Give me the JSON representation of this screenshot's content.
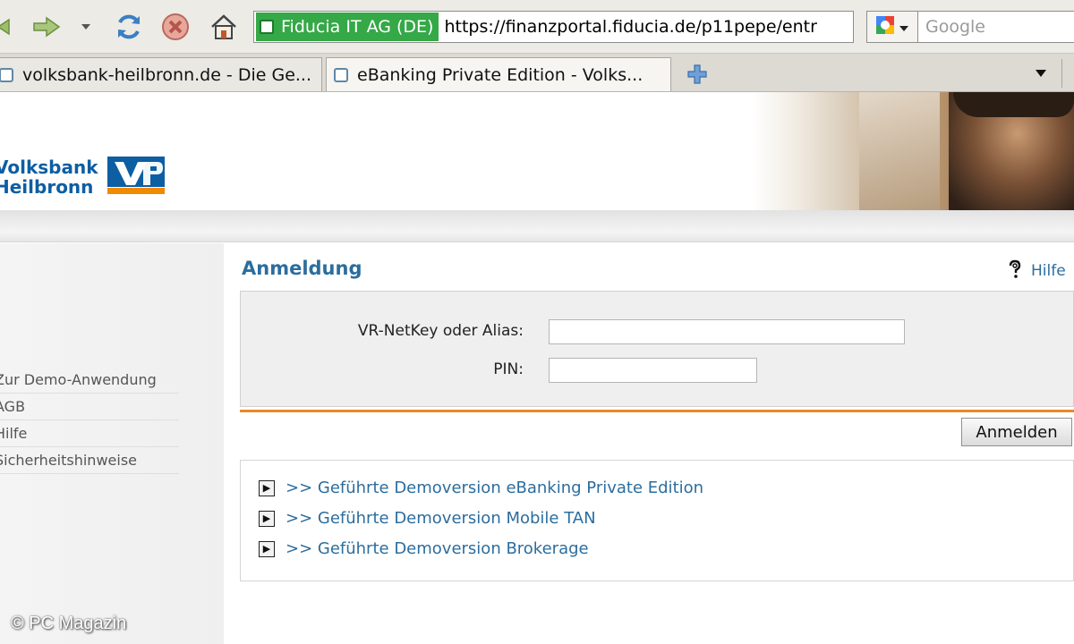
{
  "browser": {
    "identity_label": "Fiducia IT AG (DE)",
    "url": "https://finanzportal.fiducia.de/p11pepe/entr",
    "search_placeholder": "Google",
    "tabs": [
      {
        "title": "volksbank-heilbronn.de - Die Ge..."
      },
      {
        "title": "eBanking Private Edition - Volks..."
      }
    ]
  },
  "header": {
    "logo_line1": "Volksbank",
    "logo_line2": "Heilbronn"
  },
  "sidebar": {
    "items": [
      {
        "label": "Zur Demo-Anwendung"
      },
      {
        "label": "AGB"
      },
      {
        "label": "Hilfe"
      },
      {
        "label": "Sicherheitshinweise"
      }
    ]
  },
  "main": {
    "title": "Anmeldung",
    "help_label": "Hilfe",
    "netkey_label": "VR-NetKey oder Alias:",
    "pin_label": "PIN:",
    "netkey_value": "",
    "pin_value": "",
    "submit_label": "Anmelden",
    "demo_links": [
      {
        "label": ">> Geführte Demoversion eBanking Private Edition"
      },
      {
        "label": ">> Geführte Demoversion Mobile TAN"
      },
      {
        "label": ">> Geführte Demoversion Brokerage"
      }
    ]
  },
  "watermark": "© PC Magazin",
  "colors": {
    "accent_blue": "#2c6d9e",
    "brand_orange": "#e8872a",
    "identity_green": "#35a847"
  },
  "icons": [
    "back-arrow-icon",
    "forward-arrow-icon",
    "dropdown-icon",
    "reload-icon",
    "stop-icon",
    "home-icon",
    "site-favicon-icon",
    "google-icon",
    "new-tab-plus-icon",
    "help-question-icon",
    "arrow-right-box-icon"
  ]
}
